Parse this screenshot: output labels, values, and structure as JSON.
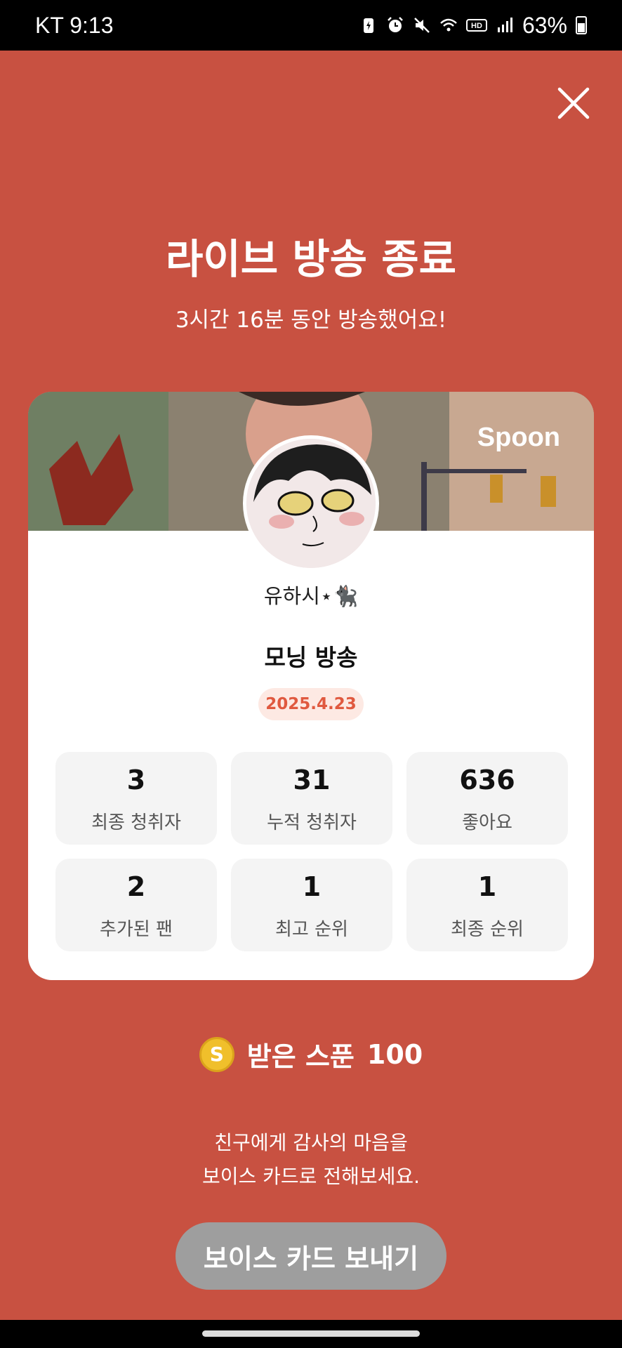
{
  "status_bar": {
    "carrier_time": "KT 9:13",
    "battery_percent": "63%",
    "icons": [
      "battery-saver-icon",
      "alarm-icon",
      "mute-icon",
      "wifi-icon",
      "hd-icon",
      "signal-icon",
      "battery-icon"
    ]
  },
  "header": {
    "close_icon": "close-icon",
    "title": "라이브 방송 종료",
    "subtitle": "3시간 16분 동안 방송했어요!"
  },
  "card": {
    "brand": "Spoon",
    "nickname": "유하시⋆🐈‍⬛",
    "broadcast_title": "모닝 방송",
    "date": "2025.4.23",
    "stats": [
      {
        "value": "3",
        "label": "최종 청취자"
      },
      {
        "value": "31",
        "label": "누적 청취자"
      },
      {
        "value": "636",
        "label": "좋아요"
      },
      {
        "value": "2",
        "label": "추가된 팬"
      },
      {
        "value": "1",
        "label": "최고 순위"
      },
      {
        "value": "1",
        "label": "최종 순위"
      }
    ]
  },
  "spoon": {
    "label": "받은 스푼",
    "amount": "100",
    "coin_symbol": "S"
  },
  "message": {
    "line1": "친구에게 감사의 마음을",
    "line2": "보이스 카드로 전해보세요."
  },
  "button": {
    "voice_card": "보이스 카드 보내기"
  },
  "colors": {
    "background": "#c85141",
    "accent": "#e0593f",
    "button_disabled": "#9e9e9e"
  }
}
